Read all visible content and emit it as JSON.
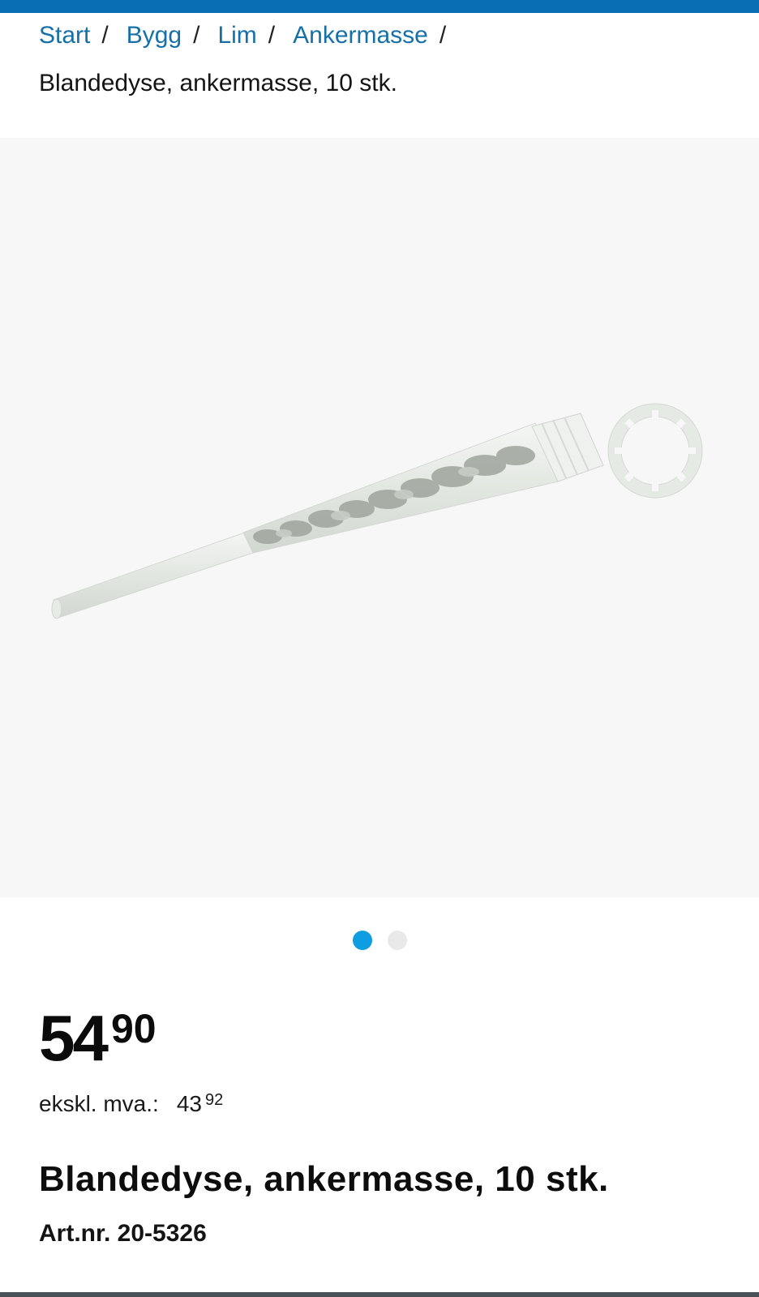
{
  "breadcrumb": {
    "items": [
      {
        "label": "Start"
      },
      {
        "label": "Bygg"
      },
      {
        "label": "Lim"
      },
      {
        "label": "Ankermasse"
      }
    ],
    "separator": "/",
    "current": "Blandedyse, ankermasse, 10 stk."
  },
  "gallery": {
    "image_alt": "Blandedyse, ankermasse, 10 stk.",
    "image_count": 2,
    "active_index": 0
  },
  "price": {
    "integer": "54",
    "decimal": "90",
    "ex_vat_label": "ekskl. mva.:",
    "ex_vat_integer": "43",
    "ex_vat_decimal": "92"
  },
  "product": {
    "title": "Blandedyse, ankermasse, 10 stk.",
    "art_nr": "Art.nr. 20-5326"
  },
  "colors": {
    "brand_blue": "#0a6eb4",
    "link_blue": "#1670a8",
    "active_dot": "#0e9de0"
  },
  "icons": {
    "product_image": "mixing-nozzle-image"
  }
}
